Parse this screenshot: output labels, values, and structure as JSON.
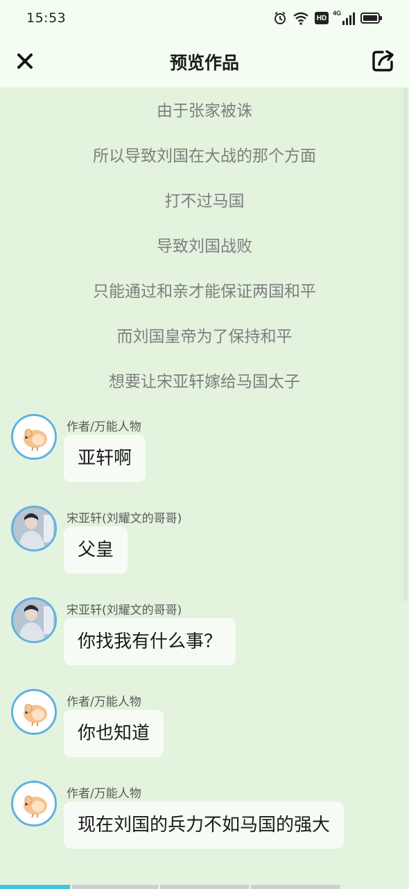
{
  "status": {
    "time": "15:53",
    "icons": [
      "alarm-icon",
      "wifi-icon",
      "hd-icon",
      "signal-4g-icon",
      "battery-icon"
    ],
    "network_label": "4G",
    "hd_label": "HD"
  },
  "header": {
    "title": "预览作品",
    "close_icon": "close-icon",
    "share_icon": "share-icon"
  },
  "narration": [
    "由于张家被诛",
    "所以导致刘国在大战的那个方面",
    "打不过马国",
    "导致刘国战败",
    "只能通过和亲才能保证两国和平",
    "而刘国皇帝为了保持和平",
    "想要让宋亚轩嫁给马国太子"
  ],
  "messages": [
    {
      "sender": "作者/万能人物",
      "text": "亚轩啊",
      "avatar": "hamster-avatar"
    },
    {
      "sender": "宋亚轩(刘耀文的哥哥)",
      "text": "父皇",
      "avatar": "photo-avatar"
    },
    {
      "sender": "宋亚轩(刘耀文的哥哥)",
      "text": "你找我有什么事？",
      "avatar": "photo-avatar"
    },
    {
      "sender": "作者/万能人物",
      "text": "你也知道",
      "avatar": "hamster-avatar"
    },
    {
      "sender": "作者/万能人物",
      "text": "现在刘国的兵力不如马国的强大",
      "avatar": "hamster-avatar"
    }
  ],
  "colors": {
    "background": "#e3f3de",
    "header_bg": "#f3fdf2",
    "bubble_bg": "#f6fcf5",
    "avatar_border": "#5fb2e0",
    "progress_active": "#3fc7d8",
    "progress_inactive": "#cfcfcf"
  },
  "progress": {
    "segments": 4,
    "current_segment": 1
  }
}
